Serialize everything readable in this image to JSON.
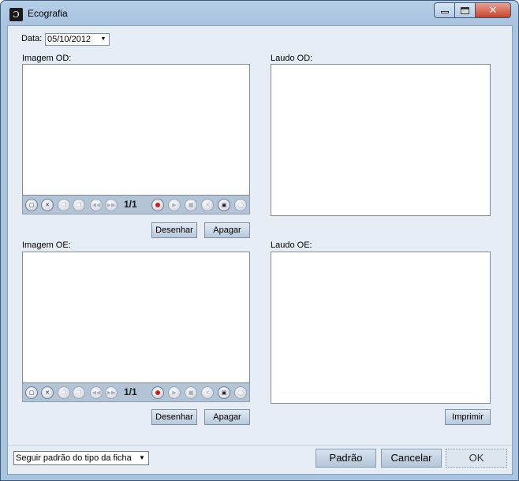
{
  "window": {
    "title": "Ecografia",
    "icon_glyph": "Ɔ"
  },
  "window_controls": {
    "close_glyph": "✕"
  },
  "date": {
    "label": "Data:",
    "value": "05/10/2012",
    "arrow": "▼"
  },
  "imagem_od": {
    "label": "Imagem OD:",
    "counter": "1/1",
    "desenhar": "Desenhar",
    "apagar": "Apagar"
  },
  "imagem_oe": {
    "label": "Imagem OE:",
    "counter": "1/1",
    "desenhar": "Desenhar",
    "apagar": "Apagar"
  },
  "laudo_od": {
    "label": "Laudo OD:"
  },
  "laudo_oe": {
    "label": "Laudo OE:",
    "imprimir": "Imprimir"
  },
  "footer": {
    "mode_select": "Seguir padrão do tipo da ficha",
    "arrow": "▼",
    "padrao": "Padrão",
    "cancelar": "Cancelar",
    "ok": "OK"
  },
  "toolbar_icons": [
    "new-image-icon",
    "delete-image-icon",
    "copy-icon",
    "paste-icon",
    "rewind-icon",
    "forward-icon",
    "record-icon",
    "play-icon",
    "stop-icon",
    "cancel-icon",
    "camera-icon",
    "ellipse-icon"
  ]
}
